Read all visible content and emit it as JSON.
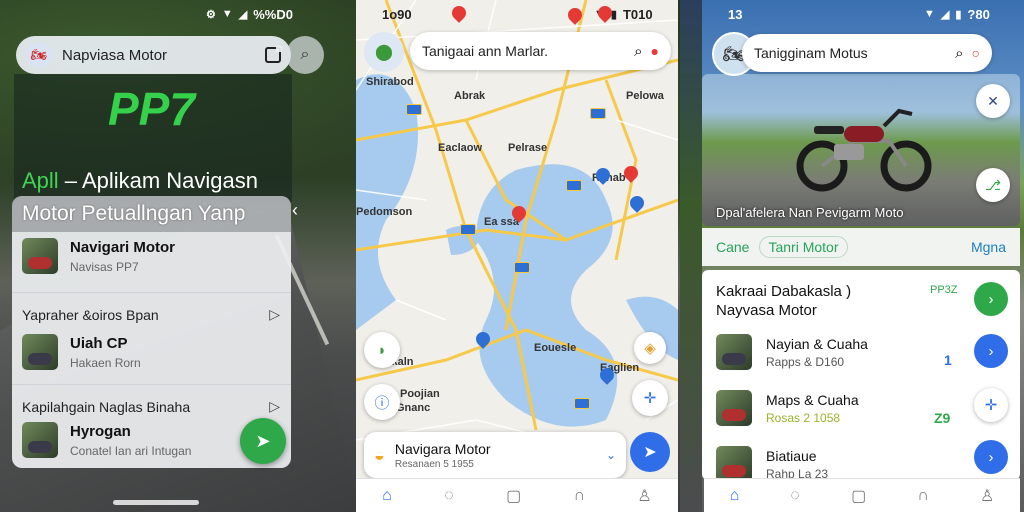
{
  "colors": {
    "accent_green": "#2fa84a",
    "accent_blue": "#2f6ee8",
    "map_water": "#a7cbef",
    "map_road": "#f6c94b",
    "pin_red": "#e53935"
  },
  "panel1": {
    "status": {
      "right": "%%D0"
    },
    "search": {
      "text": "Napviasa Motor"
    },
    "hero": {
      "brand": "PP7",
      "line1_prefix": "Apll",
      "line1_suffix": "Aplikam Navigasn",
      "line2": "Motor Petuallngan Yanp"
    },
    "list": [
      {
        "title": "Navigari Motor",
        "subtitle": "Navisas PP7"
      },
      {
        "title": "Uiah CP",
        "subtitle": "Hakaen Rorn"
      },
      {
        "title": "Hyrogan",
        "subtitle": "Conatel Ian ari Intugan"
      }
    ],
    "rows": [
      "Yapraher &oiros Bpan",
      "Kapilahgain Naglas Binaha"
    ]
  },
  "panel2": {
    "status": {
      "left": "1o90",
      "right": "T010"
    },
    "search": {
      "text": "Tanigaai ann Marlar."
    },
    "labels": [
      "Shirabod",
      "Abrak",
      "Pelowa",
      "Eaclaow",
      "Pelrase",
      "Ranab",
      "Pedomson",
      "Ea ssa",
      "Eouesle",
      "Exkaln",
      "Eaglien",
      "Poojian",
      "Gnanc"
    ],
    "card": {
      "title": "Navigara Motor",
      "subtitle": "Resanaen 5 1955"
    }
  },
  "panel3": {
    "status": {
      "left": "13",
      "right": "?80"
    },
    "search": {
      "text": "Tanigginam Motus"
    },
    "hero_caption": "Dpal'afelera Nan Pevigarm Moto",
    "tabs": {
      "first": "Cane",
      "second": "Tanri Motor",
      "right": "Mgna"
    },
    "head": {
      "title": "Kakraai Dabakasla )",
      "subtitle": "Nayvasa Motor",
      "code": "PP3Z"
    },
    "list": [
      {
        "title": "Nayian & Cuaha",
        "subtitle": "Rapps & D160",
        "num": "1"
      },
      {
        "title": "Maps & Cuaha",
        "subtitle": "Rosas 2 1058",
        "num": "Z9"
      },
      {
        "title": "Biatiaue",
        "subtitle": "Rahp La 23",
        "num": ""
      }
    ]
  }
}
